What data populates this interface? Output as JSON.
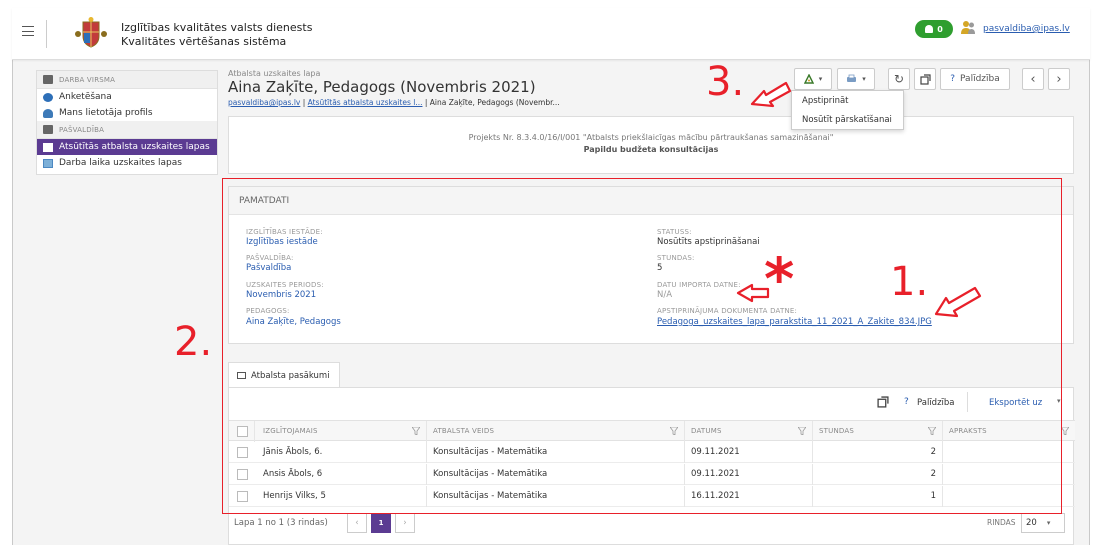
{
  "header": {
    "title_line1": "Izglītības kvalitātes valsts dienests",
    "title_line2": "Kvalitātes vērtēšanas sistēma",
    "badge_count": "0",
    "user_email": "pasvaldiba@ipas.lv"
  },
  "sidebar": {
    "group1": "DARBA VIRSMA",
    "items1": [
      "Anketēšana",
      "Mans lietotāja profils"
    ],
    "group2": "PAŠVALDĪBA",
    "items2": [
      "Atsūtītās atbalsta uzskaites lapas",
      "Darba laika uzskaites lapas"
    ]
  },
  "page": {
    "label": "Atbalsta uzskaites lapa",
    "title": "Aina Zaķīte, Pedagogs (Novembris 2021)",
    "breadcrumb": [
      "pasvaldiba@ipas.lv",
      "Atsūtītās atbalsta uzskaites l...",
      "Aina Zaķīte, Pedagogs (Novembr..."
    ],
    "help_label": "Palīdzība"
  },
  "dropdown": {
    "items": [
      "Apstiprināt",
      "Nosūtīt pārskatīšanai"
    ]
  },
  "project": {
    "line1": "Projekts Nr. 8.3.4.0/16/I/001 \"Atbalsts priekšlaicīgas mācību pārtraukšanas samazināšanai\"",
    "line2": "Papildu budžeta konsultācijas"
  },
  "pamatdati": {
    "heading": "PAMATDATI",
    "left": [
      {
        "label": "IZGLĪTĪBAS IESTĀDE:",
        "value": "Izglītības iestāde"
      },
      {
        "label": "PAŠVALDĪBA:",
        "value": "Pašvaldība"
      },
      {
        "label": "UZSKAITES PERIODS:",
        "value": "Novembris 2021"
      },
      {
        "label": "PEDAGOGS:",
        "value": "Aina Zaķīte, Pedagogs"
      }
    ],
    "right": [
      {
        "label": "STATUSS:",
        "value": "Nosūtīts apstiprināšanai"
      },
      {
        "label": "STUNDAS:",
        "value": "5"
      },
      {
        "label": "DATU IMPORTA DATNE:",
        "value": "N/A"
      },
      {
        "label": "APSTIPRINĀJUMA DOKUMENTA DATNE:",
        "value": "Pedagoga_uzskaites_lapa_parakstita_11_2021_A_Zakite_834.JPG"
      }
    ]
  },
  "table": {
    "tab_label": "Atbalsta pasākumi",
    "help_label": "Palīdzība",
    "export_label": "Eksportēt uz",
    "headers": [
      "IZGLĪTOJAMAIS",
      "ATBALSTA VEIDS",
      "DATUMS",
      "STUNDAS",
      "APRAKSTS"
    ],
    "rows": [
      [
        "Jānis Ābols, 6.",
        "Konsultācijas - Matemātika",
        "09.11.2021",
        "2",
        ""
      ],
      [
        "Ansis Ābols, 6",
        "Konsultācijas - Matemātika",
        "09.11.2021",
        "2",
        ""
      ],
      [
        "Henrijs Vilks, 5",
        "Konsultācijas - Matemātika",
        "16.11.2021",
        "1",
        ""
      ]
    ],
    "pager_text": "Lapa 1 no 1 (3 rindas)",
    "page_num": "1",
    "rows_label": "RINDAS",
    "rows_value": "20"
  },
  "annotations": {
    "num1": "1.",
    "num2": "2.",
    "num3": "3.",
    "star": "*"
  },
  "colors": {
    "accent": "#5b3b92",
    "link": "#2a5db0",
    "badge": "#2f9e2f",
    "annotation": "#e8202a"
  }
}
